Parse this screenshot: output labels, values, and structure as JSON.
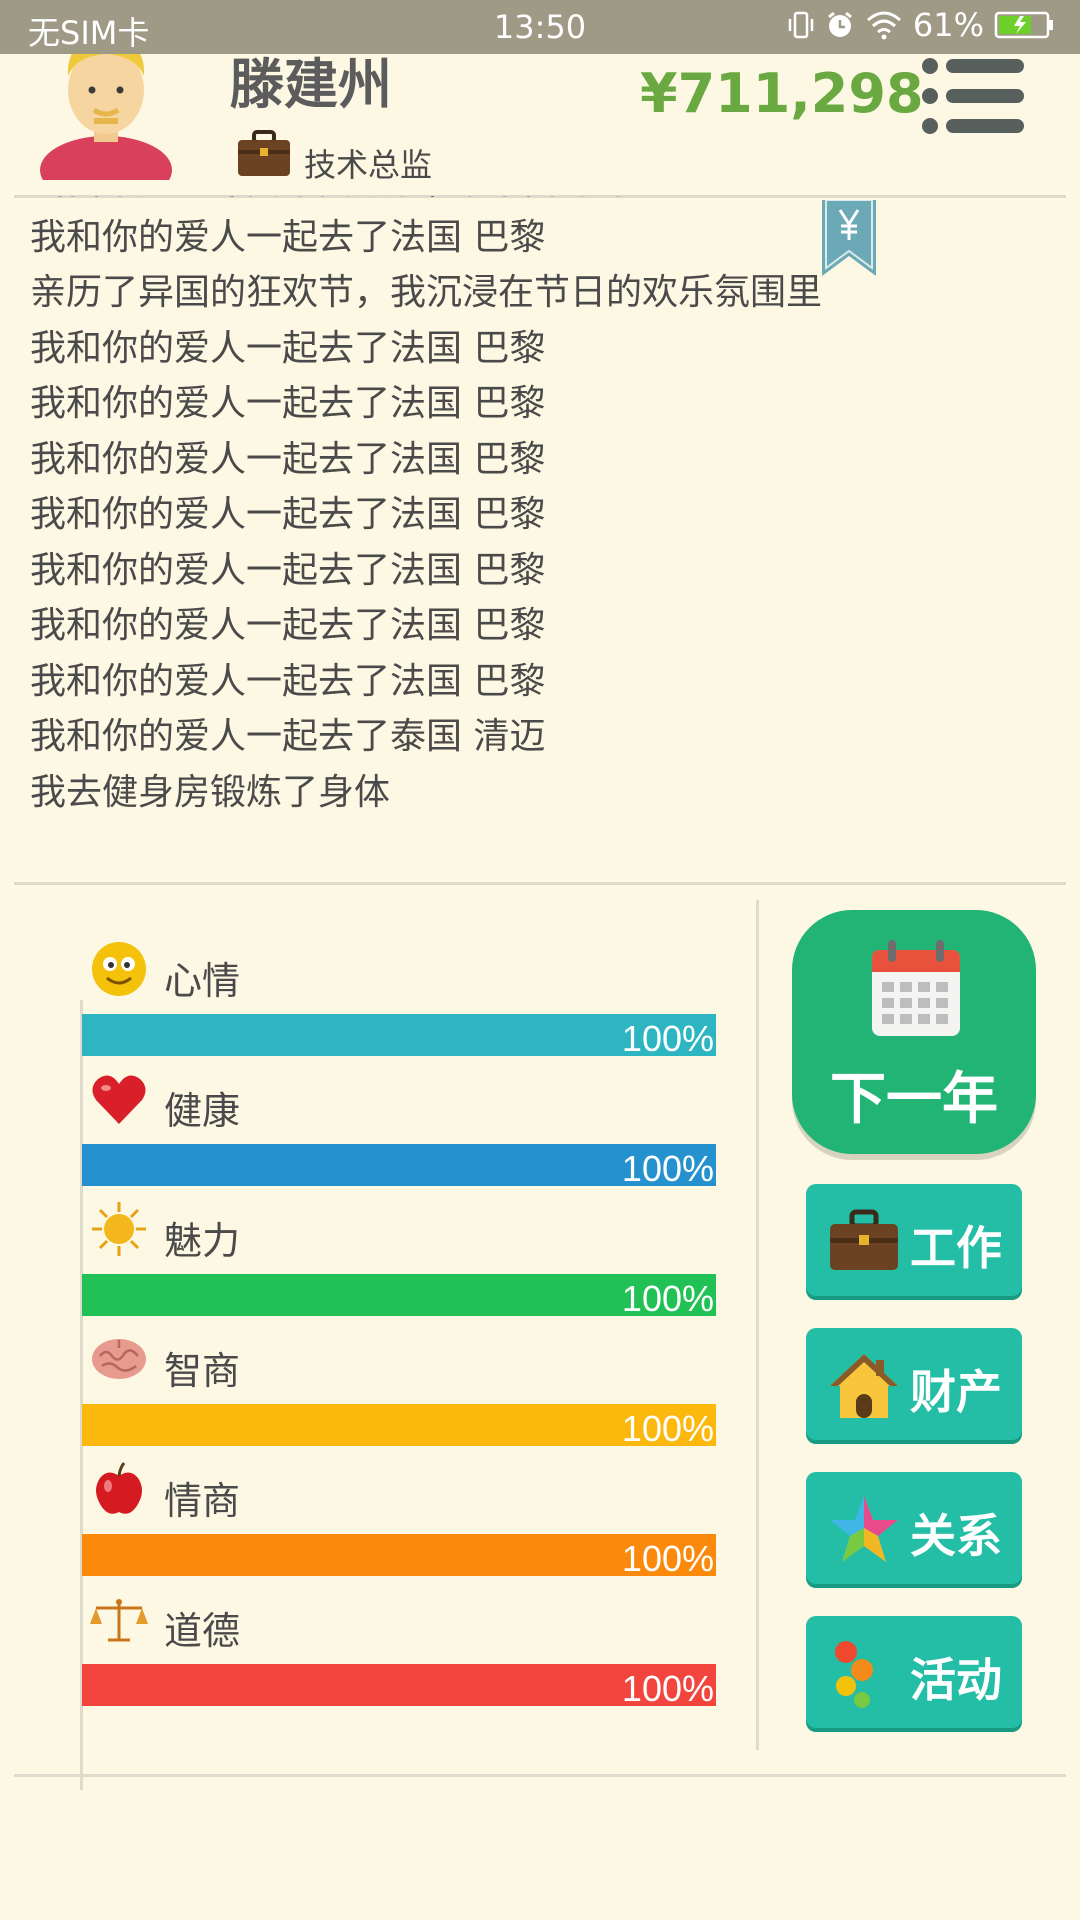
{
  "status_bar": {
    "carrier": "无SIM卡",
    "time": "13:50",
    "battery": "61%"
  },
  "header": {
    "name": "滕建州",
    "job": "技术总监",
    "money": "¥711,298"
  },
  "log": {
    "partial_top_line": "当我不是犹豫要不要放手，被我牵手了",
    "lines": [
      "我和你的爱人一起去了法国 巴黎",
      "亲历了异国的狂欢节，我沉浸在节日的欢乐氛围里",
      "我和你的爱人一起去了法国 巴黎",
      "我和你的爱人一起去了法国 巴黎",
      "我和你的爱人一起去了法国 巴黎",
      "我和你的爱人一起去了法国 巴黎",
      "我和你的爱人一起去了法国 巴黎",
      "我和你的爱人一起去了法国 巴黎",
      "我和你的爱人一起去了法国 巴黎",
      "我和你的爱人一起去了泰国 清迈",
      "我去健身房锻炼了身体"
    ]
  },
  "stats": [
    {
      "label": "心情",
      "value": "100%",
      "level": 1.0,
      "color": "#2db6c2",
      "icon": "smiley-icon"
    },
    {
      "label": "健康",
      "value": "100%",
      "level": 1.0,
      "color": "#2592cf",
      "icon": "heart-icon"
    },
    {
      "label": "魅力",
      "value": "100%",
      "level": 1.0,
      "color": "#22c155",
      "icon": "sun-icon"
    },
    {
      "label": "智商",
      "value": "100%",
      "level": 1.0,
      "color": "#fdb80d",
      "icon": "brain-icon"
    },
    {
      "label": "情商",
      "value": "100%",
      "level": 1.0,
      "color": "#fb8a0c",
      "icon": "apple-icon"
    },
    {
      "label": "道德",
      "value": "100%",
      "level": 1.0,
      "color": "#f2453d",
      "icon": "scales-icon"
    }
  ],
  "actions": {
    "next_year": "下一年",
    "work": "工作",
    "assets": "财产",
    "relations": "关系",
    "activities": "活动"
  }
}
